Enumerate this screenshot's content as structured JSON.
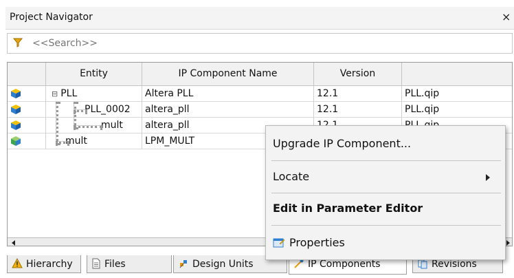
{
  "panel": {
    "title": "Project Navigator",
    "close_label": "×"
  },
  "search": {
    "placeholder": "<<Search>>",
    "value": ""
  },
  "table": {
    "headers": [
      "",
      "Entity",
      "IP Component Name",
      "Version",
      ""
    ],
    "rows": [
      {
        "icon": "ip-cube-icon",
        "expand": "⊟",
        "entity": "PLL",
        "ip_name": "Altera PLL",
        "version": "12.1",
        "file": "PLL.qip"
      },
      {
        "icon": "ip-cube-icon",
        "expand": "",
        "entity": "PLL_0002",
        "ip_name": "altera_pll",
        "version": "12.1",
        "file": "PLL.qip"
      },
      {
        "icon": "ip-cube-icon",
        "expand": "",
        "entity": "mult",
        "ip_name": "altera_pll",
        "version": "12.1",
        "file": "PLL.qip"
      },
      {
        "icon": "ip-cube-green-icon",
        "expand": "",
        "entity": "mult",
        "ip_name": "LPM_MULT",
        "version": "",
        "file": ""
      }
    ]
  },
  "tabs": [
    {
      "label": "Hierarchy",
      "icon": "warning-triangle-icon"
    },
    {
      "label": "Files",
      "icon": "file-icon"
    },
    {
      "label": "Design Units",
      "icon": "design-units-icon"
    },
    {
      "label": "IP Components",
      "icon": "ip-components-icon",
      "active": true
    },
    {
      "label": "Revisions",
      "icon": "revisions-icon"
    }
  ],
  "context_menu": {
    "items": [
      {
        "label": "Upgrade IP Component..."
      },
      {
        "label": "Locate",
        "submenu": true
      },
      {
        "label": "Edit in Parameter Editor",
        "bold": true
      },
      {
        "label": "Properties",
        "icon": "properties-icon"
      }
    ]
  },
  "colors": {
    "cube_blue": "#2f7fd0",
    "cube_yellow": "#f2c200",
    "cube_green": "#3aa84a",
    "filter": "#e6a500"
  }
}
